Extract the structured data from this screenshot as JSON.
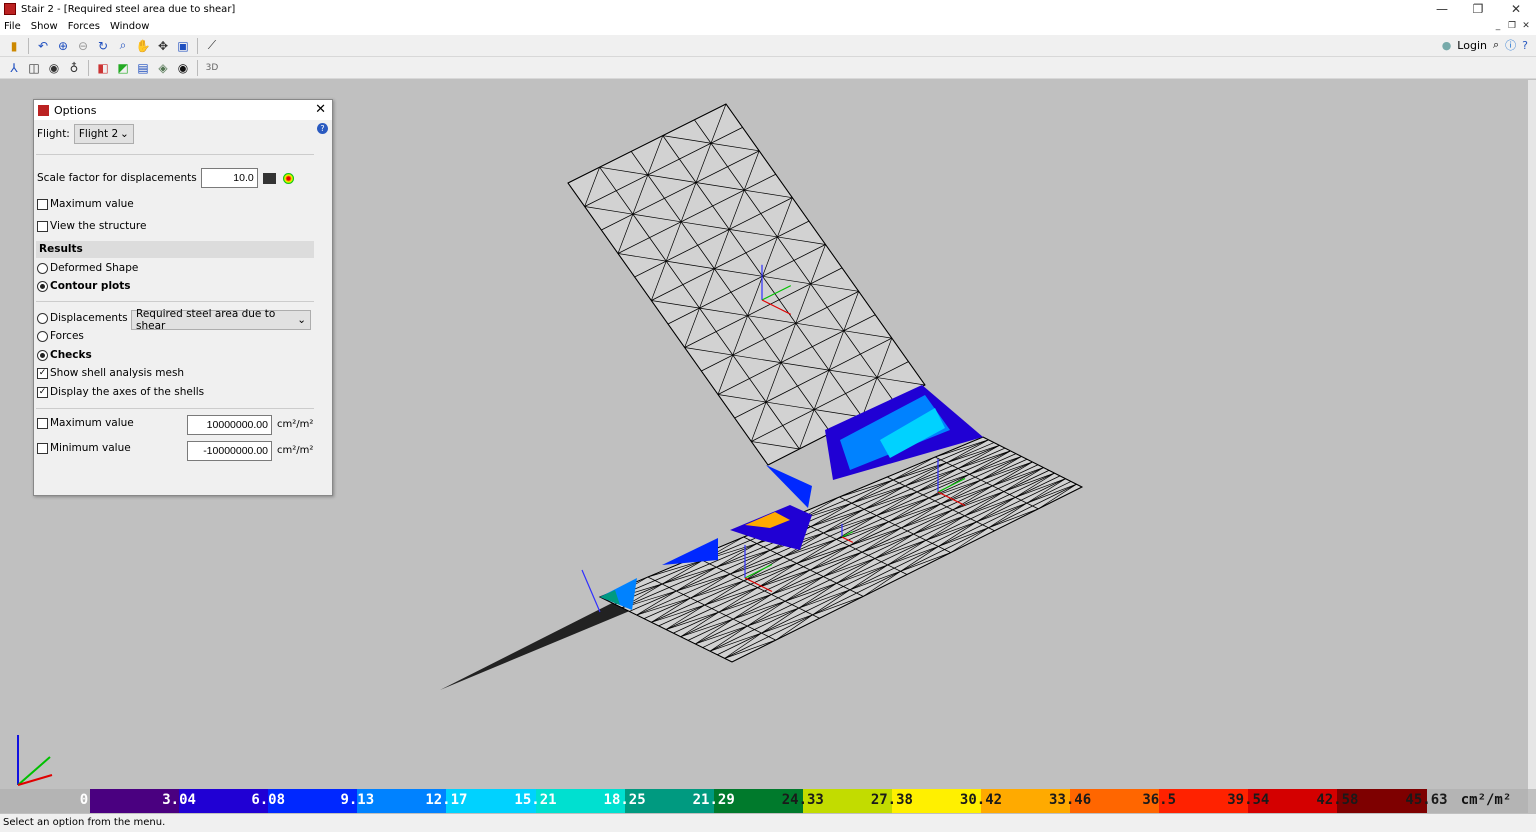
{
  "window": {
    "title": "Stair 2 - [Required steel area due to shear]",
    "minimize": "—",
    "restore": "❐",
    "close": "✕"
  },
  "menu": [
    "File",
    "Show",
    "Forces",
    "Window"
  ],
  "toolbar1": [
    "exit-icon",
    "zoom-previous-icon",
    "zoom-all-icon",
    "zoom-out-icon",
    "rotate-icon",
    "zoom-window-icon",
    "pan-icon",
    "move-icon",
    "refresh-view-icon",
    "axes-scale-icon"
  ],
  "toolbar2": [
    "axes-icon",
    "cube-view-icon",
    "rotate-x-icon",
    "rotate-z-icon",
    "front-view-icon",
    "side-view-icon",
    "top-view-icon",
    "layers-icon",
    "visibility-icon",
    "3d-view-icon"
  ],
  "right": {
    "login": "Login"
  },
  "options": {
    "title": "Options",
    "flight_label": "Flight:",
    "flight_value": "Flight 2",
    "scale_label": "Scale factor for displacements",
    "scale_value": "10.0",
    "max_value_cb": "Maximum value",
    "view_structure_cb": "View the structure",
    "results_header": "Results",
    "deformed": "Deformed Shape",
    "contour": "Contour plots",
    "displacements": "Displacements",
    "forces": "Forces",
    "checks": "Checks",
    "result_type": "Required steel area due to shear",
    "show_mesh": "Show shell analysis mesh",
    "display_axes": "Display the axes of the shells",
    "max_label": "Maximum value",
    "max_input": "10000000.00",
    "min_label": "Minimum value",
    "min_input": "-10000000.00",
    "unit": "cm²/m²"
  },
  "legend": {
    "labels": [
      "0",
      "3.04",
      "6.08",
      "9.13",
      "12.17",
      "15.21",
      "18.25",
      "21.29",
      "24.33",
      "27.38",
      "30.42",
      "33.46",
      "36.5",
      "39.54",
      "42.58",
      "45.63"
    ],
    "colors": [
      "#4a0080",
      "#2000d4",
      "#0028ff",
      "#0082ff",
      "#00d2ff",
      "#00e0d0",
      "#009a80",
      "#007a2c",
      "#c2dc00",
      "#fff000",
      "#ffaa00",
      "#ff6600",
      "#ff2200",
      "#d40000",
      "#7e0000"
    ],
    "unit": "cm²/m²"
  },
  "status": "Select an option from the menu."
}
